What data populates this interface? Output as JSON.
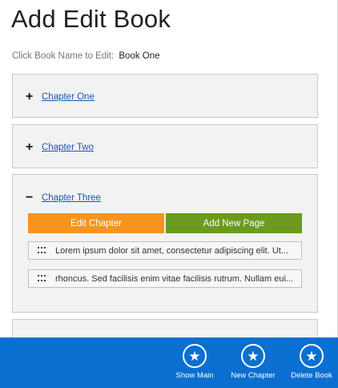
{
  "header": {
    "title": "Add Edit Book",
    "instruction": "Click Book Name to Edit:",
    "book_name": "Book One"
  },
  "chapters": [
    {
      "toggle": "+",
      "name": "Chapter One",
      "expanded": false
    },
    {
      "toggle": "+",
      "name": "Chapter Two",
      "expanded": false
    },
    {
      "toggle": "−",
      "name": "Chapter Three",
      "expanded": true,
      "edit_label": "Edit Chapter",
      "add_page_label": "Add New Page",
      "pages": [
        "Lorem ipsum dolor sit amet, consectetur adipiscing elit. Ut...",
        "rhoncus. Sed facilisis enim vitae facilisis rutrum. Nullam eui..."
      ]
    }
  ],
  "appbar": {
    "buttons": [
      {
        "label": "Show Main",
        "icon": "star-icon"
      },
      {
        "label": "New Chapter",
        "icon": "star-icon"
      },
      {
        "label": "Delete Book",
        "icon": "star-icon"
      }
    ]
  },
  "colors": {
    "edit_button": "#f7941d",
    "add_button": "#6b9b1e",
    "appbar": "#0a6fd1",
    "link": "#1a55b3"
  }
}
